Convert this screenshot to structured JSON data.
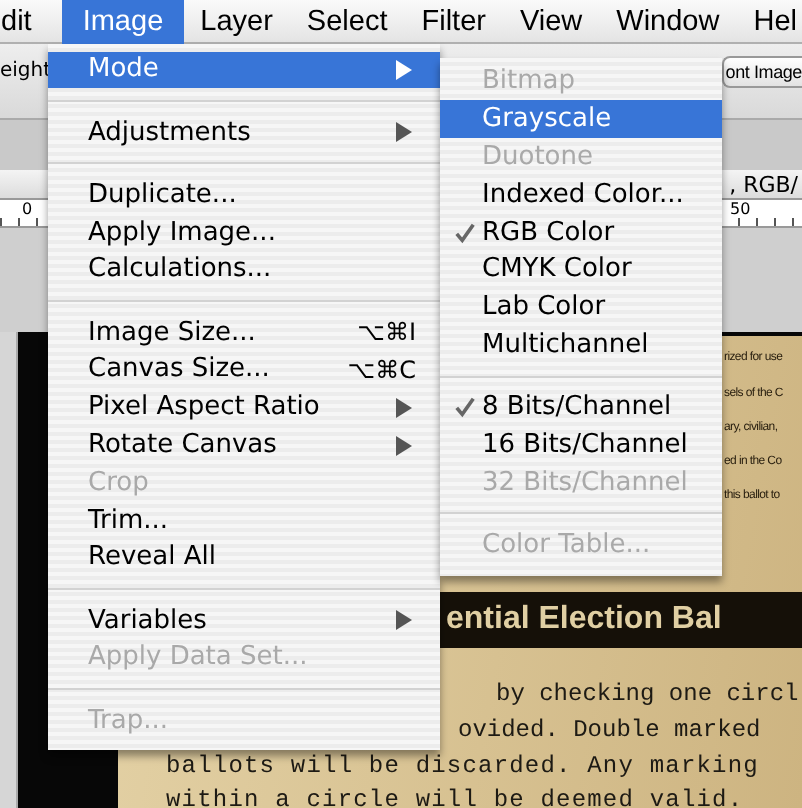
{
  "menubar": [
    {
      "label": "dit",
      "selected": false
    },
    {
      "label": "Image",
      "selected": true
    },
    {
      "label": "Layer",
      "selected": false
    },
    {
      "label": "Select",
      "selected": false
    },
    {
      "label": "Filter",
      "selected": false
    },
    {
      "label": "View",
      "selected": false
    },
    {
      "label": "Window",
      "selected": false
    },
    {
      "label": "Hel",
      "selected": false
    }
  ],
  "options_bar": {
    "left_text": "eight",
    "right_button": "ont Image"
  },
  "document": {
    "title_fragment": ", RGB/",
    "ruler_labels": [
      "0",
      "50"
    ],
    "heading": "ential Election Bal",
    "lines": [
      {
        "text": "by checking one circl"
      },
      {
        "text": "ovided. Double marked"
      },
      {
        "text": "ballots will be discarded. Any marking"
      },
      {
        "text": "within a circle will be deemed valid."
      }
    ],
    "side_fragments": [
      "rized for use",
      "sels of the C",
      "ary, civilian,",
      "ed in the Co",
      "this ballot to"
    ]
  },
  "image_menu": [
    {
      "kind": "item",
      "label": "Mode",
      "submenu": true,
      "selected": true,
      "disabled": false
    },
    {
      "kind": "separator"
    },
    {
      "kind": "item",
      "label": "Adjustments",
      "submenu": true,
      "selected": false,
      "disabled": false
    },
    {
      "kind": "separator"
    },
    {
      "kind": "item",
      "label": "Duplicate...",
      "submenu": false,
      "selected": false,
      "disabled": false
    },
    {
      "kind": "item",
      "label": "Apply Image...",
      "submenu": false,
      "selected": false,
      "disabled": false
    },
    {
      "kind": "item",
      "label": "Calculations...",
      "submenu": false,
      "selected": false,
      "disabled": false
    },
    {
      "kind": "separator"
    },
    {
      "kind": "item",
      "label": "Image Size...",
      "shortcut": "⌥⌘I",
      "submenu": false,
      "selected": false,
      "disabled": false
    },
    {
      "kind": "item",
      "label": "Canvas Size...",
      "shortcut": "⌥⌘C",
      "submenu": false,
      "selected": false,
      "disabled": false
    },
    {
      "kind": "item",
      "label": "Pixel Aspect Ratio",
      "submenu": true,
      "selected": false,
      "disabled": false
    },
    {
      "kind": "item",
      "label": "Rotate Canvas",
      "submenu": true,
      "selected": false,
      "disabled": false
    },
    {
      "kind": "item",
      "label": "Crop",
      "submenu": false,
      "selected": false,
      "disabled": true
    },
    {
      "kind": "item",
      "label": "Trim...",
      "submenu": false,
      "selected": false,
      "disabled": false
    },
    {
      "kind": "item",
      "label": "Reveal All",
      "submenu": false,
      "selected": false,
      "disabled": false
    },
    {
      "kind": "separator"
    },
    {
      "kind": "item",
      "label": "Variables",
      "submenu": true,
      "selected": false,
      "disabled": false
    },
    {
      "kind": "item",
      "label": "Apply Data Set...",
      "submenu": false,
      "selected": false,
      "disabled": true
    },
    {
      "kind": "separator"
    },
    {
      "kind": "item",
      "label": "Trap...",
      "submenu": false,
      "selected": false,
      "disabled": true
    }
  ],
  "mode_submenu": [
    {
      "kind": "item",
      "label": "Bitmap",
      "checked": false,
      "selected": false,
      "disabled": true
    },
    {
      "kind": "item",
      "label": "Grayscale",
      "checked": false,
      "selected": true,
      "disabled": false
    },
    {
      "kind": "item",
      "label": "Duotone",
      "checked": false,
      "selected": false,
      "disabled": true
    },
    {
      "kind": "item",
      "label": "Indexed Color...",
      "checked": false,
      "selected": false,
      "disabled": false
    },
    {
      "kind": "item",
      "label": "RGB Color",
      "checked": true,
      "selected": false,
      "disabled": false
    },
    {
      "kind": "item",
      "label": "CMYK Color",
      "checked": false,
      "selected": false,
      "disabled": false
    },
    {
      "kind": "item",
      "label": "Lab Color",
      "checked": false,
      "selected": false,
      "disabled": false
    },
    {
      "kind": "item",
      "label": "Multichannel",
      "checked": false,
      "selected": false,
      "disabled": false
    },
    {
      "kind": "separator"
    },
    {
      "kind": "item",
      "label": "8 Bits/Channel",
      "checked": true,
      "selected": false,
      "disabled": false
    },
    {
      "kind": "item",
      "label": "16 Bits/Channel",
      "checked": false,
      "selected": false,
      "disabled": false
    },
    {
      "kind": "item",
      "label": "32 Bits/Channel",
      "checked": false,
      "selected": false,
      "disabled": true
    },
    {
      "kind": "separator"
    },
    {
      "kind": "item",
      "label": "Color Table...",
      "checked": false,
      "selected": false,
      "disabled": true
    }
  ]
}
